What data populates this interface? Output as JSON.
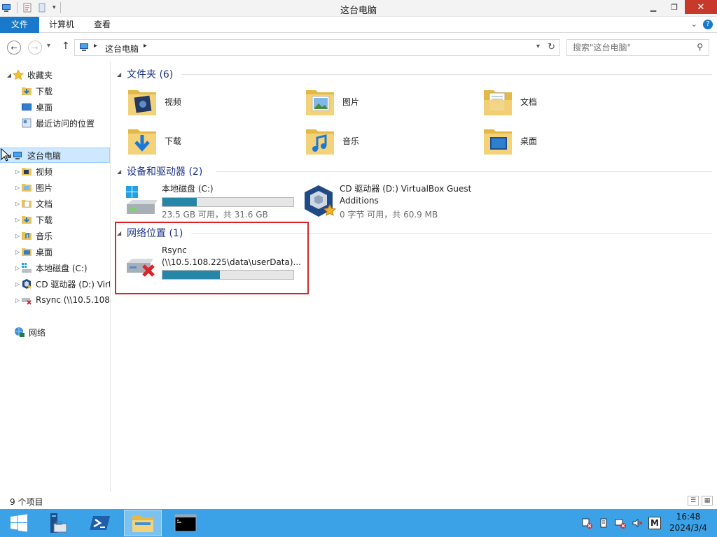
{
  "window": {
    "title": "这台电脑"
  },
  "titlebar": {
    "qat_icons": [
      "this-pc-icon",
      "properties-icon",
      "new-folder-icon",
      "customize-dropdown-icon"
    ],
    "buttons": [
      "minimize",
      "maximize",
      "close"
    ]
  },
  "ribbon": {
    "tabs": [
      {
        "label": "文件"
      },
      {
        "label": "计算机"
      },
      {
        "label": "查看"
      }
    ]
  },
  "address": {
    "crumb": "这台电脑",
    "search_placeholder": "搜索\"这台电脑\""
  },
  "sidebar": {
    "favorites": {
      "label": "收藏夹",
      "items": [
        {
          "label": "下载",
          "icon": "downloads-icon"
        },
        {
          "label": "桌面",
          "icon": "desktop-icon"
        },
        {
          "label": "最近访问的位置",
          "icon": "recent-places-icon"
        }
      ]
    },
    "this_pc": {
      "label": "这台电脑",
      "items": [
        {
          "label": "视频",
          "icon": "videos-folder-icon"
        },
        {
          "label": "图片",
          "icon": "pictures-folder-icon"
        },
        {
          "label": "文档",
          "icon": "documents-folder-icon"
        },
        {
          "label": "下载",
          "icon": "downloads-folder-icon"
        },
        {
          "label": "音乐",
          "icon": "music-folder-icon"
        },
        {
          "label": "桌面",
          "icon": "desktop-folder-icon"
        },
        {
          "label": "本地磁盘 (C:)",
          "icon": "local-disk-icon"
        },
        {
          "label": "CD 驱动器 (D:) Virt",
          "icon": "cd-drive-icon"
        },
        {
          "label": "Rsync (\\\\10.5.108.2",
          "icon": "network-drive-icon"
        }
      ]
    },
    "network": {
      "label": "网络"
    }
  },
  "content": {
    "folders_group": "文件夹 (6)",
    "folders": [
      {
        "label": "视频"
      },
      {
        "label": "图片"
      },
      {
        "label": "文档"
      },
      {
        "label": "下载"
      },
      {
        "label": "音乐"
      },
      {
        "label": "桌面"
      }
    ],
    "devices_group": "设备和驱动器 (2)",
    "drives": {
      "c": {
        "name": "本地磁盘 (C:)",
        "info": "23.5 GB 可用，共 31.6 GB",
        "used_fraction": 0.26
      },
      "d": {
        "name_line1": "CD 驱动器 (D:) VirtualBox Guest",
        "name_line2": "Additions",
        "info": "0 字节 可用，共 60.9 MB"
      }
    },
    "network_group": "网络位置 (1)",
    "network_drive": {
      "name_line1": "Rsync",
      "name_line2": "(\\\\10.5.108.225\\data\\userData)...",
      "used_fraction": 0.44
    }
  },
  "statusbar": {
    "count": "9 个项目"
  },
  "taskbar": {
    "items": [
      "start-button",
      "server-manager",
      "powershell",
      "file-explorer",
      "command-prompt"
    ],
    "tray_ime": "M",
    "time": "16:48",
    "date": "2024/3/4"
  },
  "colors": {
    "accent": "#1979ca",
    "taskbar": "#3ca2e8",
    "drive_fill": "#2686a8",
    "highlight_box": "#d9252a",
    "group_title": "#1e3287"
  }
}
